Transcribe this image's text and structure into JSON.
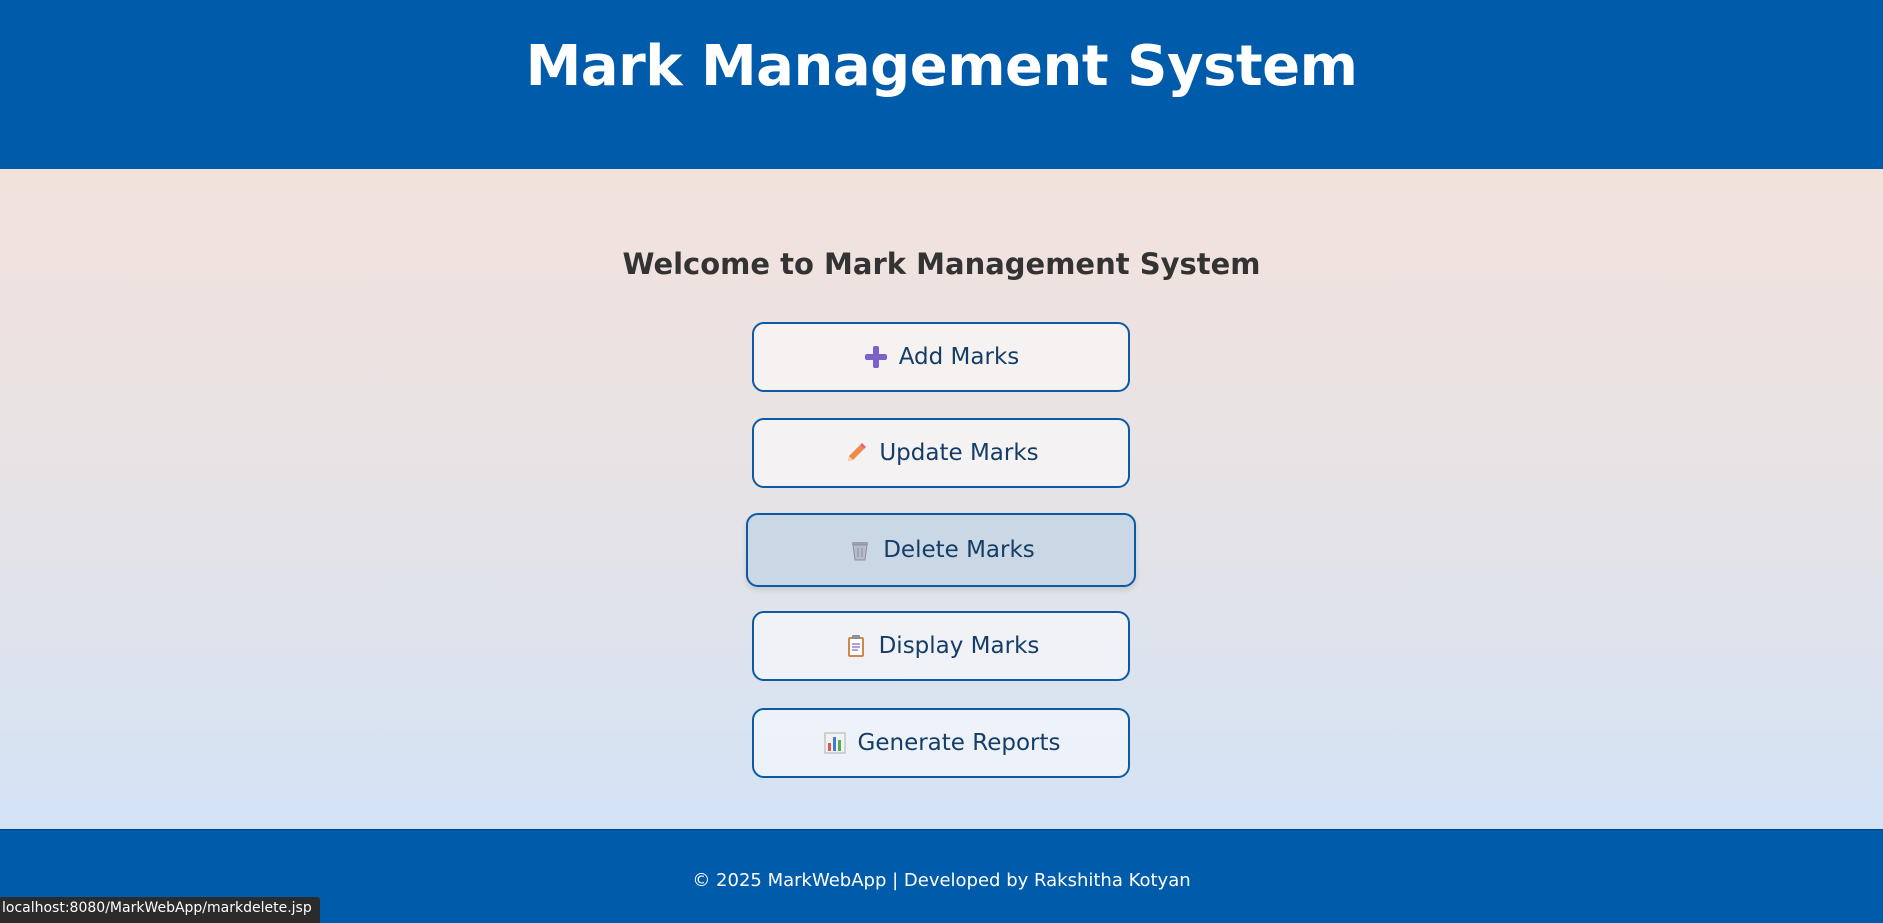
{
  "header": {
    "title": "Mark Management System"
  },
  "main": {
    "welcome": "Welcome to Mark Management System",
    "buttons": [
      {
        "label": "Add Marks",
        "icon": "plus-icon"
      },
      {
        "label": "Update Marks",
        "icon": "pencil-icon"
      },
      {
        "label": "Delete Marks",
        "icon": "trash-icon"
      },
      {
        "label": "Display Marks",
        "icon": "clipboard-icon"
      },
      {
        "label": "Generate Reports",
        "icon": "bar-chart-icon"
      }
    ]
  },
  "footer": {
    "text": "© 2025 MarkWebApp | Developed by Rakshitha Kotyan"
  },
  "status_bar": {
    "url": "localhost:8080/MarkWebApp/markdelete.jsp"
  },
  "colors": {
    "primary": "#005bab",
    "button_border": "#0b5aa3",
    "button_text": "#153d66"
  }
}
